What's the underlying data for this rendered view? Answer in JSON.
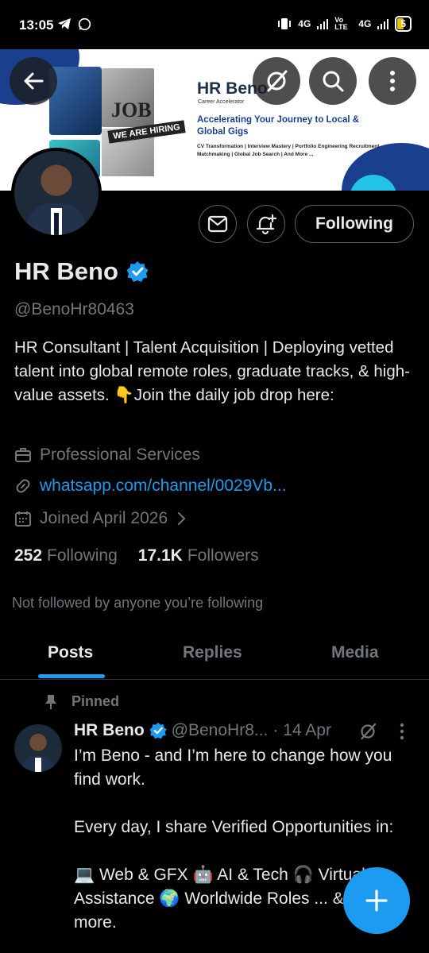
{
  "status_bar": {
    "time": "13:05",
    "network_1": "4G",
    "volte": "Vo LTE",
    "network_2": "4G",
    "battery": "5"
  },
  "banner": {
    "brand": "HR Beno",
    "brand_sub": "Career Accelerator",
    "tagline": "Accelerating Your Journey to Local & Global Gigs",
    "services": "CV Transformation | Interview Mastery | Portfolio Engineering Recruitment Matchmaking | Global Job Search | And More ...",
    "photo_text_job": "JOB",
    "photo_text_hiring": "WE ARE HIRING"
  },
  "profile": {
    "name": "HR Beno",
    "handle": "@BenoHr80463",
    "bio": "HR Consultant | Talent Acquisition | Deploying vetted talent into global remote roles, graduate tracks, & high-value assets. 👇Join the daily job drop here:",
    "category": "Professional Services",
    "link": "whatsapp.com/channel/0029Vb...",
    "joined": "Joined April 2026",
    "following_count": "252",
    "following_label": "Following",
    "followers_count": "17.1K",
    "followers_label": "Followers",
    "not_followed": "Not followed by anyone you’re following"
  },
  "actions": {
    "following_button": "Following"
  },
  "tabs": [
    {
      "label": "Posts",
      "active": true
    },
    {
      "label": "Replies",
      "active": false
    },
    {
      "label": "Media",
      "active": false
    }
  ],
  "pinned_post": {
    "pinned_label": "Pinned",
    "author": "HR Beno",
    "handle": "@BenoHr8...",
    "time": "· 14 Apr",
    "text": "I’m Beno - and I’m here to change how you find work.\n\nEvery day, I share Verified Opportunities in:\n\n💻 Web & GFX 🤖 AI & Tech 🎧 Virtual Assistance 🌍 Worldwide Roles ... & many more."
  },
  "colors": {
    "accent": "#1d9bf0",
    "background": "#000000",
    "secondary_text": "#71767b"
  },
  "icons": [
    "back-arrow-icon",
    "grok-icon",
    "search-icon",
    "more-vertical-icon",
    "mail-icon",
    "bell-plus-icon",
    "verified-badge-icon",
    "briefcase-icon",
    "link-icon",
    "calendar-icon",
    "chevron-right-icon",
    "pin-icon",
    "plus-icon"
  ]
}
